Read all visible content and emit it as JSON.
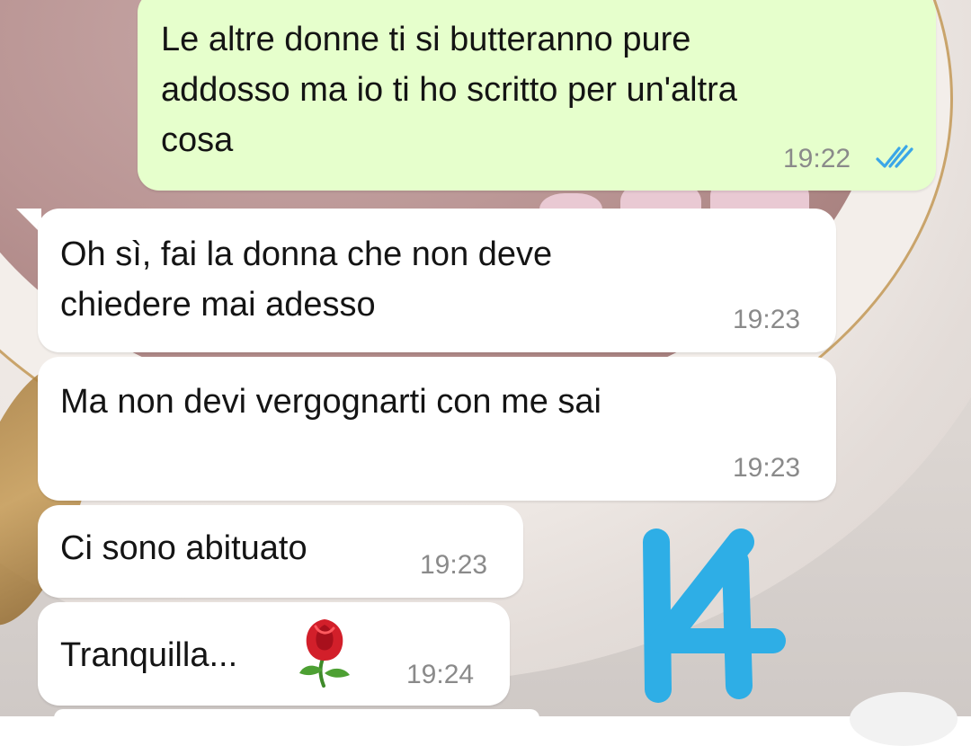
{
  "messages": [
    {
      "direction": "outgoing",
      "text": "Le altre donne ti si butteranno pure\naddosso ma io ti ho scritto per un'altra\ncosa",
      "time": "19:22",
      "status_icon": "double-check-read-icon"
    },
    {
      "direction": "incoming",
      "text": "Oh sì, fai la donna che non deve\nchiedere mai adesso",
      "time": "19:23"
    },
    {
      "direction": "incoming",
      "text": "Ma non devi vergognarti con me sai",
      "time": "19:23"
    },
    {
      "direction": "incoming",
      "text": "Ci sono abituato",
      "time": "19:23"
    },
    {
      "direction": "incoming",
      "text": "Tranquilla...",
      "emoji": "rose-icon",
      "time": "19:24"
    }
  ],
  "overlay": {
    "handwritten_number": "14",
    "color": "#2eaee6"
  },
  "colors": {
    "outgoing_bubble": "#e6ffcc",
    "incoming_bubble": "#ffffff",
    "read_ticks": "#3aa6e8",
    "timestamp": "#8a8a8a"
  }
}
